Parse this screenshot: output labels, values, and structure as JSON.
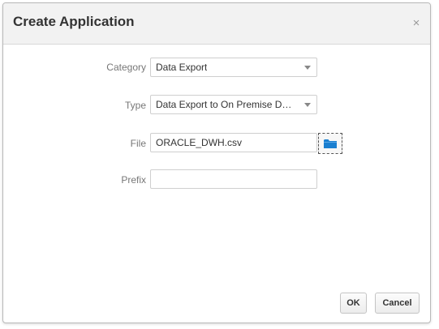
{
  "dialog": {
    "title": "Create Application",
    "close_glyph": "×"
  },
  "form": {
    "category": {
      "label": "Category",
      "value": "Data Export"
    },
    "type": {
      "label": "Type",
      "value": "Data Export to On Premise Dat..."
    },
    "file": {
      "label": "File",
      "value": "ORACLE_DWH.csv",
      "browse_icon": "folder-icon"
    },
    "prefix": {
      "label": "Prefix",
      "value": ""
    }
  },
  "buttons": {
    "ok": "OK",
    "cancel": "Cancel"
  },
  "colors": {
    "folder_icon": "#1a7fd0",
    "header_bg": "#f2f2f2"
  }
}
